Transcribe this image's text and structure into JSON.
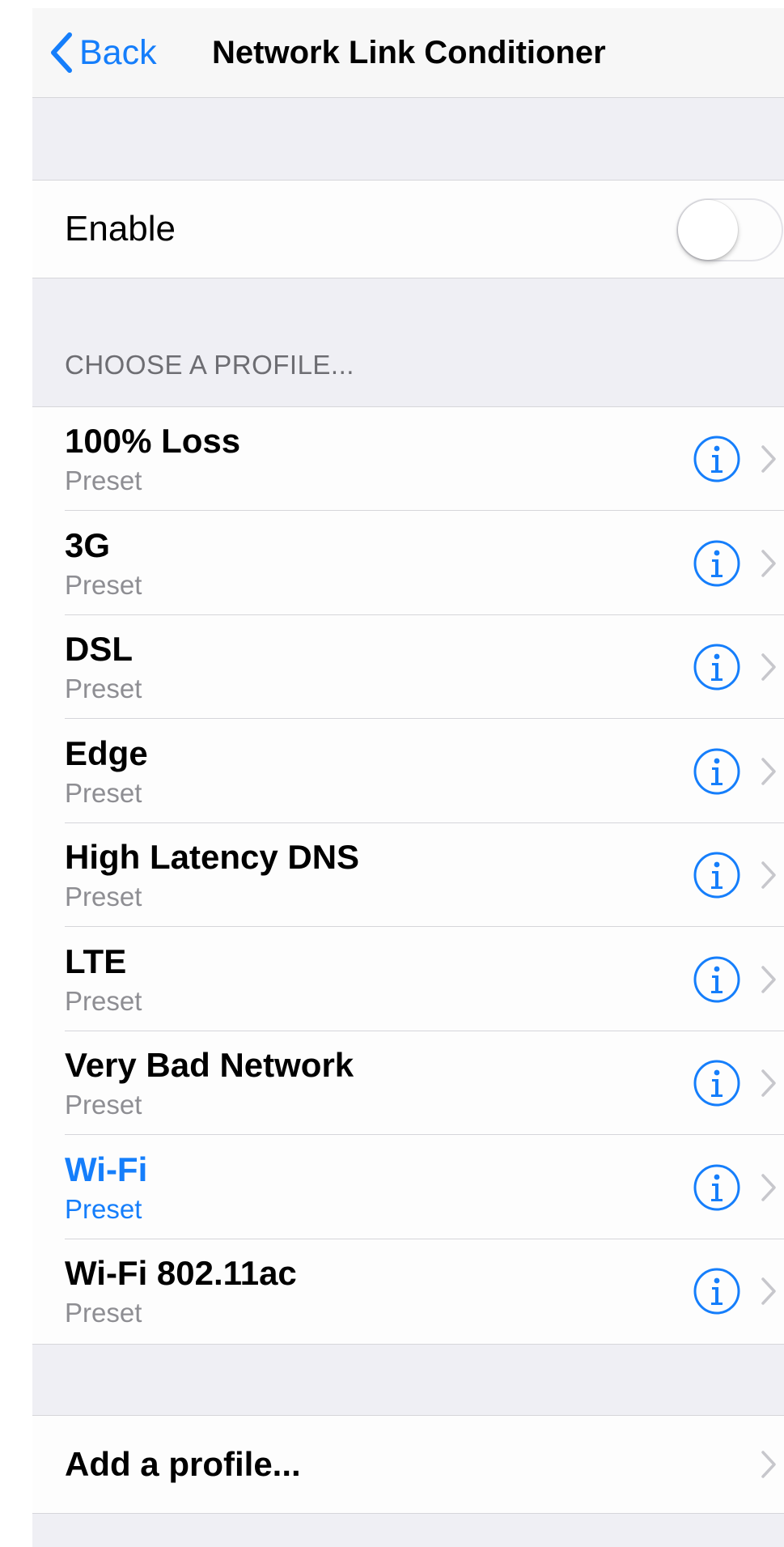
{
  "nav": {
    "back_label": "Back",
    "title": "Network Link Conditioner"
  },
  "enable": {
    "label": "Enable",
    "on": false
  },
  "profiles": {
    "header": "CHOOSE A PROFILE...",
    "items": [
      {
        "title": "100% Loss",
        "subtitle": "Preset"
      },
      {
        "title": "3G",
        "subtitle": "Preset"
      },
      {
        "title": "DSL",
        "subtitle": "Preset"
      },
      {
        "title": "Edge",
        "subtitle": "Preset"
      },
      {
        "title": "High Latency DNS",
        "subtitle": "Preset"
      },
      {
        "title": "LTE",
        "subtitle": "Preset"
      },
      {
        "title": "Very Bad Network",
        "subtitle": "Preset"
      },
      {
        "title": "Wi-Fi",
        "subtitle": "Preset",
        "selected": true
      },
      {
        "title": "Wi-Fi 802.11ac",
        "subtitle": "Preset"
      }
    ],
    "row_icons": [
      "info-icon",
      "chevron-right-icon"
    ]
  },
  "add_profile": {
    "label": "Add a profile..."
  },
  "colors": {
    "accent": "#157efb",
    "background": "#efeff4",
    "cell": "#fdfdfd",
    "secondary_text": "#8e8e93",
    "separator": "#d6d6da"
  }
}
